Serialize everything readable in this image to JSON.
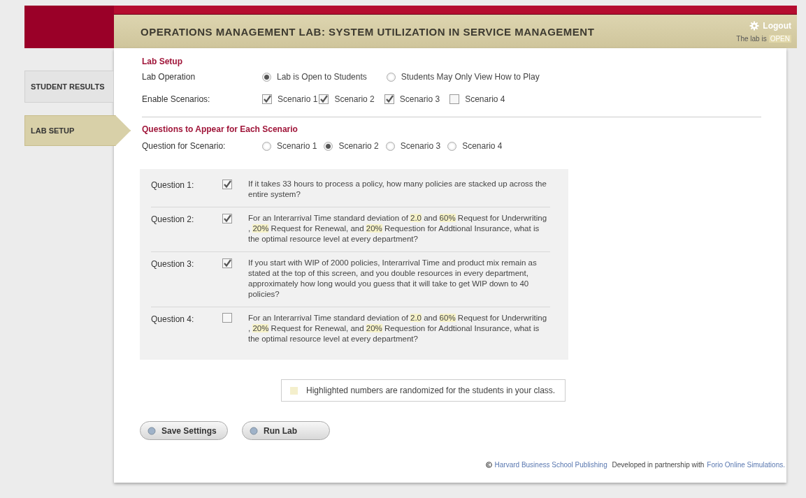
{
  "header": {
    "title": "OPERATIONS MANAGEMENT LAB:  SYSTEM UTILIZATION IN SERVICE MANAGEMENT",
    "logout": "Logout",
    "status_label": "The lab is",
    "status_value": "OPEN"
  },
  "sidebar": {
    "items": [
      {
        "label": "STUDENT RESULTS",
        "selected": false
      },
      {
        "label": "LAB SETUP",
        "selected": true
      }
    ]
  },
  "lab_setup": {
    "heading": "Lab Setup",
    "lab_operation": {
      "label": "Lab Operation",
      "options": [
        {
          "label": "Lab is Open to Students",
          "selected": true
        },
        {
          "label": "Students May Only View How to Play",
          "selected": false
        }
      ]
    },
    "enable_scenarios": {
      "label": "Enable Scenarios:",
      "options": [
        {
          "label": "Scenario 1",
          "checked": true
        },
        {
          "label": "Scenario 2",
          "checked": true
        },
        {
          "label": "Scenario 3",
          "checked": true
        },
        {
          "label": "Scenario 4",
          "checked": false
        }
      ]
    }
  },
  "questions_section": {
    "heading": "Questions to Appear for Each Scenario",
    "scenario_picker": {
      "label": "Question for Scenario:",
      "options": [
        {
          "label": "Scenario 1",
          "selected": false
        },
        {
          "label": "Scenario 2",
          "selected": true
        },
        {
          "label": "Scenario 3",
          "selected": false
        },
        {
          "label": "Scenario 4",
          "selected": false
        }
      ]
    },
    "questions": [
      {
        "label": "Question 1:",
        "checked": true,
        "parts": [
          {
            "text": "If it takes 33 hours to process a policy, how many policies are stacked up across the entire system?",
            "highlighted": false
          }
        ]
      },
      {
        "label": "Question 2:",
        "checked": true,
        "parts": [
          {
            "text": "For an Interarrival Time standard deviation of ",
            "highlighted": false
          },
          {
            "text": "2.0",
            "highlighted": true
          },
          {
            "text": " and ",
            "highlighted": false
          },
          {
            "text": "60%",
            "highlighted": true
          },
          {
            "text": " Request for Underwriting ,  ",
            "highlighted": false
          },
          {
            "text": "20%",
            "highlighted": true
          },
          {
            "text": " Request for Renewal,  and ",
            "highlighted": false
          },
          {
            "text": "20%",
            "highlighted": true
          },
          {
            "text": " Requestion for Addtional Insurance, what is the optimal resource level at every department?",
            "highlighted": false
          }
        ]
      },
      {
        "label": "Question 3:",
        "checked": true,
        "parts": [
          {
            "text": "If you start with WIP of 2000 policies, Interarrival Time and product mix remain as stated at the top of this screen, and you double resources in every department, approximately how long would you guess that it will take to get WIP down to 40 policies?",
            "highlighted": false
          }
        ]
      },
      {
        "label": "Question 4:",
        "checked": false,
        "parts": [
          {
            "text": "For an Interarrival Time standard deviation of ",
            "highlighted": false
          },
          {
            "text": "2.0",
            "highlighted": true
          },
          {
            "text": " and ",
            "highlighted": false
          },
          {
            "text": "60%",
            "highlighted": true
          },
          {
            "text": " Request for Underwriting ,  ",
            "highlighted": false
          },
          {
            "text": "20%",
            "highlighted": true
          },
          {
            "text": " Request for Renewal,  and ",
            "highlighted": false
          },
          {
            "text": "20%",
            "highlighted": true
          },
          {
            "text": " Requestion for Addtional Insurance, what is the optimal resource level at every department?",
            "highlighted": false
          }
        ]
      }
    ],
    "legend": "Highlighted numbers are randomized for the students in your class."
  },
  "buttons": [
    "Save Settings",
    "Run Lab"
  ],
  "footer": {
    "publisher_link": "Harvard Business School Publishing",
    "partner_text": "Developed in partnership with",
    "partner_link": "Forio Online Simulations."
  }
}
